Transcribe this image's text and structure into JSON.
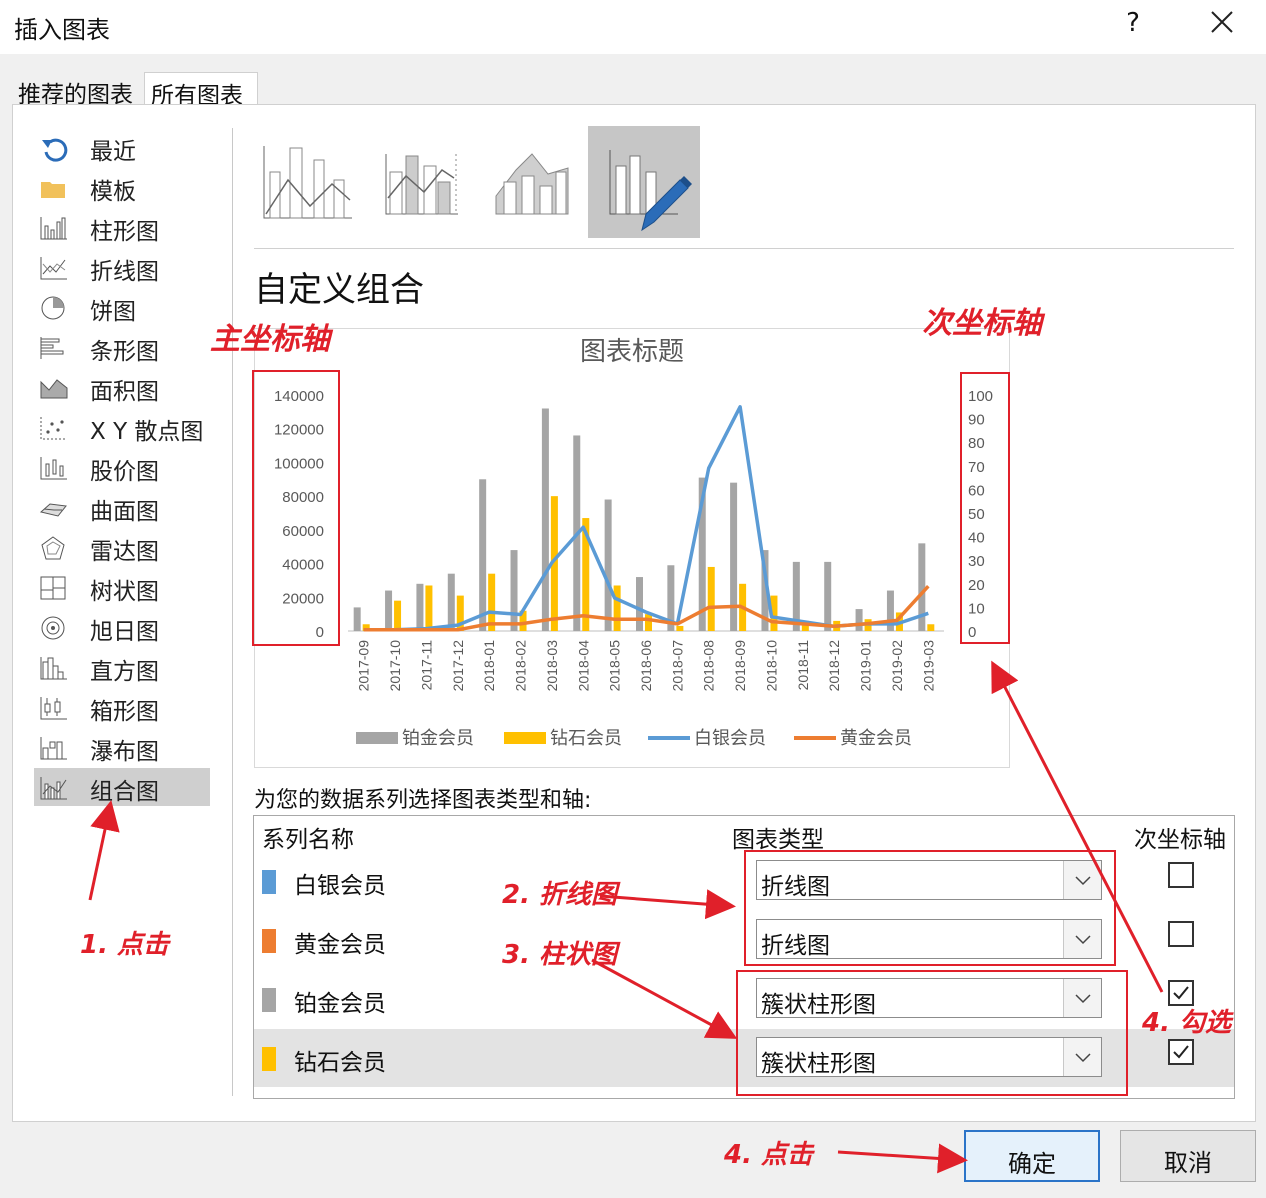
{
  "window": {
    "title": "插入图表",
    "help": "?",
    "close": "close"
  },
  "tabs": [
    {
      "label": "推荐的图表",
      "active": false
    },
    {
      "label": "所有图表",
      "active": true
    }
  ],
  "categories": [
    {
      "label": "最近",
      "icon": "recent-icon"
    },
    {
      "label": "模板",
      "icon": "folder-icon"
    },
    {
      "label": "柱形图",
      "icon": "column-chart-icon"
    },
    {
      "label": "折线图",
      "icon": "line-chart-icon"
    },
    {
      "label": "饼图",
      "icon": "pie-chart-icon"
    },
    {
      "label": "条形图",
      "icon": "bar-chart-icon"
    },
    {
      "label": "面积图",
      "icon": "area-chart-icon"
    },
    {
      "label": "X Y 散点图",
      "icon": "scatter-chart-icon"
    },
    {
      "label": "股价图",
      "icon": "stock-chart-icon"
    },
    {
      "label": "曲面图",
      "icon": "surface-chart-icon"
    },
    {
      "label": "雷达图",
      "icon": "radar-chart-icon"
    },
    {
      "label": "树状图",
      "icon": "treemap-chart-icon"
    },
    {
      "label": "旭日图",
      "icon": "sunburst-chart-icon"
    },
    {
      "label": "直方图",
      "icon": "histogram-chart-icon"
    },
    {
      "label": "箱形图",
      "icon": "boxplot-chart-icon"
    },
    {
      "label": "瀑布图",
      "icon": "waterfall-chart-icon"
    },
    {
      "label": "组合图",
      "icon": "combo-chart-icon",
      "selected": true
    }
  ],
  "section_title": "自定义组合",
  "instruction": "为您的数据系列选择图表类型和轴:",
  "table": {
    "headers": {
      "series": "系列名称",
      "type": "图表类型",
      "secondary": "次坐标轴"
    },
    "rows": [
      {
        "name": "白银会员",
        "color": "#5b9bd5",
        "type": "折线图",
        "secondary": false
      },
      {
        "name": "黄金会员",
        "color": "#ed7d31",
        "type": "折线图",
        "secondary": false
      },
      {
        "name": "铂金会员",
        "color": "#a5a5a5",
        "type": "簇状柱形图",
        "secondary": true
      },
      {
        "name": "钻石会员",
        "color": "#ffc000",
        "type": "簇状柱形图",
        "secondary": true,
        "selected": true
      }
    ]
  },
  "buttons": {
    "ok": "确定",
    "cancel": "取消"
  },
  "annotations": {
    "primary_axis": "主坐标轴",
    "secondary_axis": "次坐标轴",
    "step1": "1. 点击",
    "step2": "2. 折线图",
    "step3": "3. 柱状图",
    "step4a": "4. 勾选",
    "step4b": "4.  点击",
    "color": "#e0202a"
  },
  "chart_data": {
    "type": "bar",
    "title": "图表标题",
    "categories": [
      "2017-09",
      "2017-10",
      "2017-11",
      "2017-12",
      "2018-01",
      "2018-02",
      "2018-03",
      "2018-04",
      "2018-05",
      "2018-06",
      "2018-07",
      "2018-08",
      "2018-09",
      "2018-10",
      "2018-11",
      "2018-12",
      "2019-01",
      "2019-02",
      "2019-03"
    ],
    "y_left": {
      "ticks": [
        "140000",
        "120000",
        "100000",
        "80000",
        "60000",
        "40000",
        "20000",
        "0"
      ],
      "ylim": [
        0,
        140000
      ]
    },
    "y_right": {
      "ticks": [
        "100",
        "90",
        "80",
        "70",
        "60",
        "50",
        "40",
        "30",
        "20",
        "10",
        "0"
      ],
      "ylim": [
        0,
        100
      ]
    },
    "series": [
      {
        "name": "铂金会员",
        "kind": "bar",
        "axis": "left",
        "color": "#a5a5a5",
        "values": [
          14000,
          24000,
          28000,
          34000,
          90000,
          48000,
          132000,
          116000,
          78000,
          32000,
          39000,
          91000,
          88000,
          48000,
          41000,
          41000,
          13000,
          24000,
          52000
        ]
      },
      {
        "name": "钻石会员",
        "kind": "bar",
        "axis": "left",
        "color": "#ffc000",
        "values": [
          4000,
          18000,
          27000,
          21000,
          34000,
          12000,
          80000,
          67000,
          27000,
          10000,
          3000,
          38000,
          28000,
          21000,
          6000,
          6000,
          7000,
          11000,
          4000
        ]
      },
      {
        "name": "白银会员",
        "kind": "line",
        "axis": "right",
        "color": "#5b9bd5",
        "values": [
          0.5,
          0.5,
          1,
          2.5,
          8,
          7,
          29,
          44,
          14,
          8,
          3,
          69,
          95,
          6,
          4,
          2,
          3,
          3,
          7.5
        ]
      },
      {
        "name": "黄金会员",
        "kind": "line",
        "axis": "right",
        "color": "#ed7d31",
        "values": [
          0.5,
          0.5,
          0.5,
          0.5,
          3,
          3,
          5,
          6.5,
          5,
          5,
          3,
          10,
          10.5,
          4,
          3,
          2,
          3,
          4.5,
          19
        ]
      }
    ],
    "legend_position": "bottom",
    "grid": false
  }
}
